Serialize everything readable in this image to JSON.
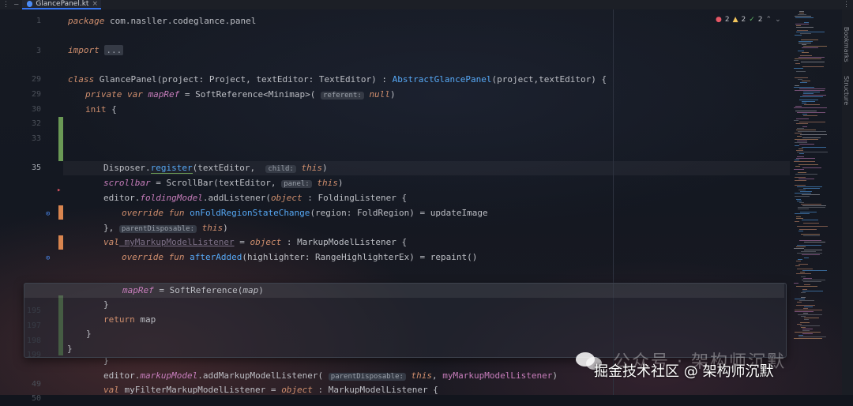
{
  "tab": {
    "title": "GlancePanel.kt",
    "close": "×"
  },
  "toolbar": {
    "errors": "2",
    "warnings": "2",
    "checks": "2"
  },
  "sidebar": {
    "bookmarks": "Bookmarks",
    "structure": "Structure"
  },
  "watermark": {
    "line1": "公众号 · 架构师沉默",
    "line2": "掘金技术社区 @ 架构师沉默"
  },
  "line_numbers": [
    "1",
    "",
    "3",
    "",
    "29",
    "29",
    "30",
    "",
    "32",
    "33",
    "",
    "35",
    "",
    "",
    "",
    "",
    "",
    "",
    "",
    "",
    "",
    "",
    "",
    "",
    "",
    "",
    "195",
    "197",
    "198",
    "199",
    "",
    "",
    "49",
    "50"
  ],
  "code": {
    "l_package_kw": "package",
    "l_package": " com.nasller.codeglance.panel",
    "l_import_kw": "import",
    "l_import_fold": "...",
    "l_class_kw": "class",
    "l_class_rest1": " GlancePanel(project: Project, textEditor: TextEditor) : ",
    "l_class_abs": "AbstractGlancePanel",
    "l_class_rest2": "(project,textEditor) {",
    "l_priv": "private var",
    "l_mapref": " mapRef",
    "l_mapref_rest": " = SoftReference<Minimap>(",
    "l_mapref_hint": "referent:",
    "l_mapref_null": "null",
    "l_mapref_end": ")",
    "l_init": "init",
    "l_init_rest": " {",
    "l_disp": "Disposer.",
    "l_disp_fn": "register",
    "l_disp_rest": "(textEditor, ",
    "l_disp_hint": "child:",
    "l_disp_this": "this",
    "l_disp_end": ")",
    "l_scroll": "scrollbar",
    "l_scroll_rest": " = ScrollBar(textEditor, ",
    "l_scroll_hint": "panel:",
    "l_scroll_this": "this",
    "l_scroll_end": ")",
    "l_fold_a": "editor.",
    "l_fold_b": "foldingModel",
    "l_fold_c": ".addListener(",
    "l_fold_obj": "object",
    "l_fold_d": " : FoldingListener {",
    "l_over1": "override fun",
    "l_over1_fn": " onFoldRegionStateChange",
    "l_over1_rest": "(region: FoldRegion) = updateImage",
    "l_close1": "}, ",
    "l_close1_hint": "parentDisposable:",
    "l_close1_this": "this",
    "l_close1_end": ")",
    "l_val": "val",
    "l_val_name": " myMarkupModelListener",
    "l_val_rest": " = ",
    "l_val_obj": "object",
    "l_val_end": " : MarkupModelListener {",
    "l_over2": "override fun",
    "l_over2_fn": " afterAdded",
    "l_over2_rest": "(highlighter: RangeHighlighterEx) = repaint()",
    "l_pop_mapref": "mapRef",
    "l_pop_rest": " = SoftReference(",
    "l_pop_map": "map",
    "l_pop_end": ")",
    "l_pop_brace1": "}",
    "l_ret": "return",
    "l_ret_rest": " map",
    "l_pop_brace2": "}",
    "l_pop_brace3": "}",
    "l_b1": "}",
    "l_mk_a": "editor.",
    "l_mk_b": "markupModel",
    "l_mk_c": ".addMarkupModelListener(",
    "l_mk_hint": "parentDisposable:",
    "l_mk_this": " this",
    "l_mk_d": ", ",
    "l_mk_e": "myMarkupModelListener",
    "l_mk_end": ")",
    "l_v2": "val",
    "l_v2_rest": " myFilterMarkupModelListener = ",
    "l_v2_obj": "object",
    "l_v2_end": " : MarkupModelListener {"
  },
  "colors": {
    "accent": "#3574f0",
    "keyword": "#cf8e6d",
    "function": "#56a8f5",
    "property": "#c77dbb",
    "added": "#6a9955",
    "modified": "#d9854f"
  }
}
